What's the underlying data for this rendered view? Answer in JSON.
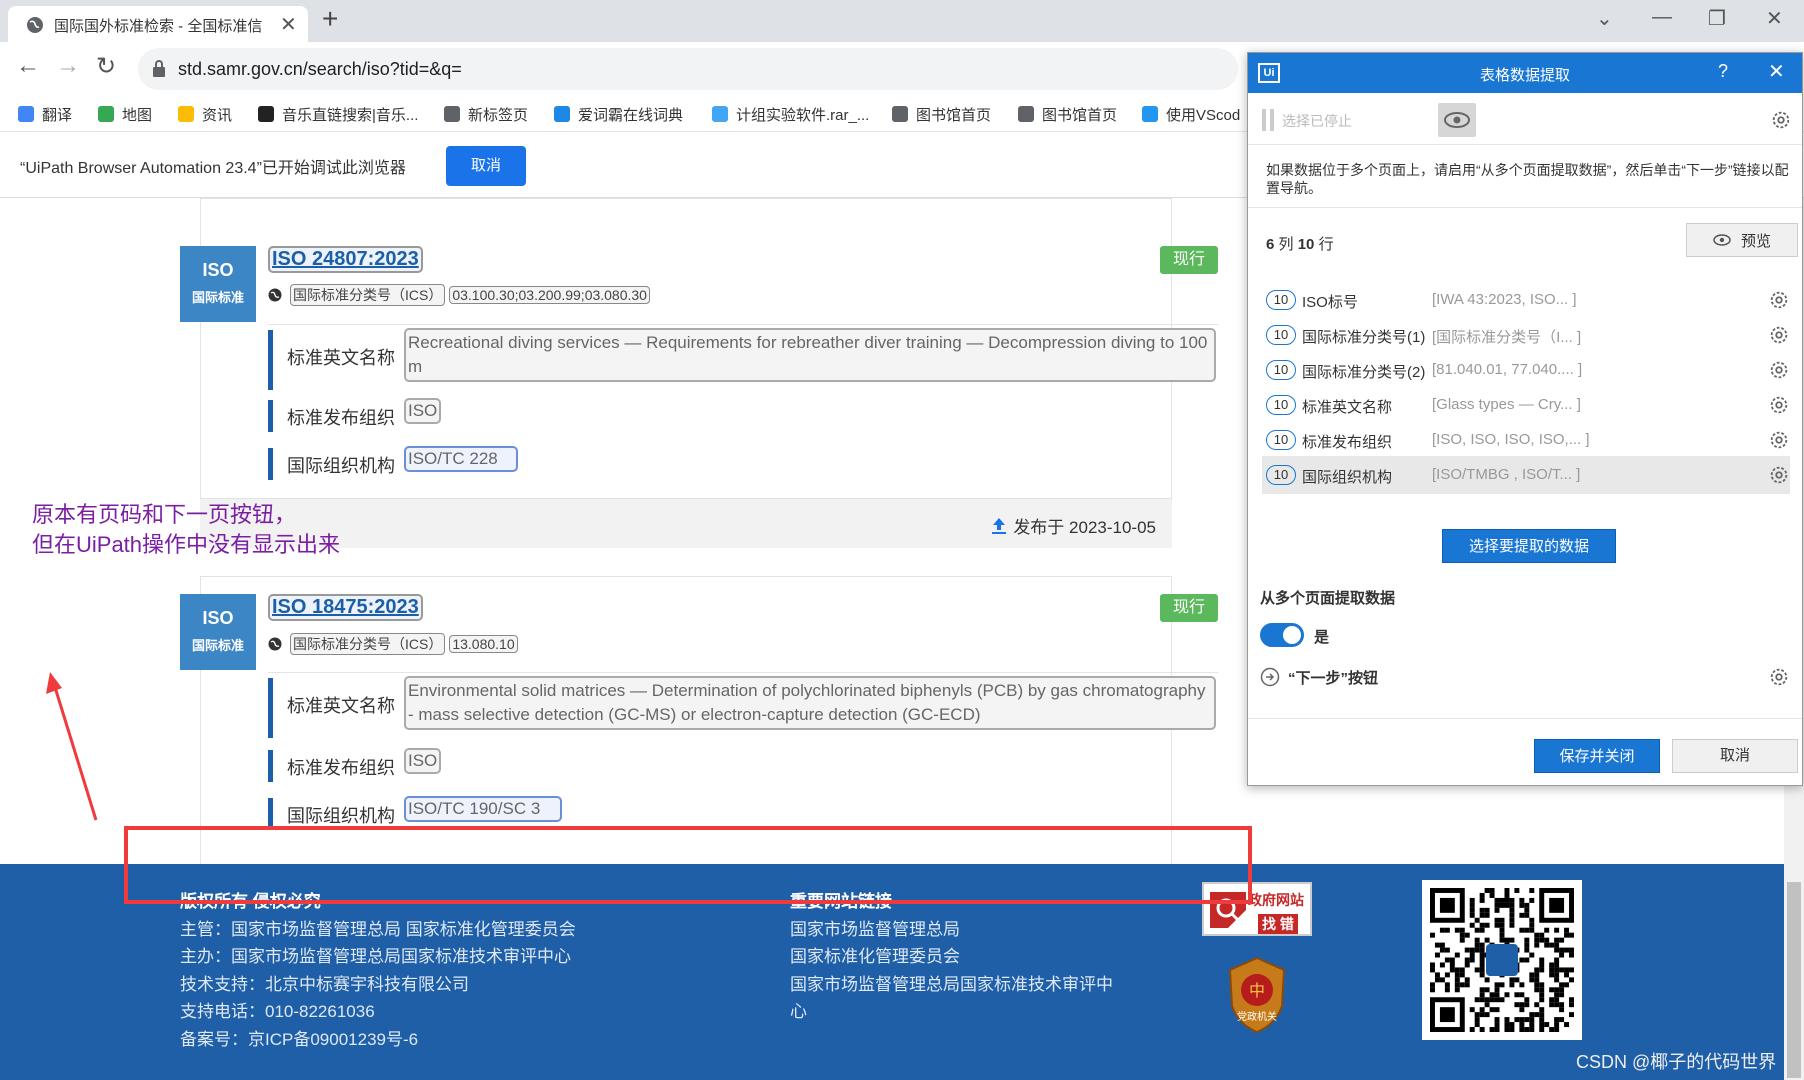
{
  "browser": {
    "tab_title": "国际国外标准检索 - 全国标准信",
    "tab_close": "✕",
    "new_tab": "+",
    "url": "std.samr.gov.cn/search/iso?tid=&q=",
    "window_controls": {
      "chevron": "⌄",
      "minimize": "—",
      "restore": "❐",
      "close": "✕"
    },
    "nav": {
      "back": "←",
      "forward": "→",
      "reload": "↻"
    },
    "bookmarks": [
      {
        "label": "翻译",
        "color": "#4285f4"
      },
      {
        "label": "地图",
        "color": "#34a853"
      },
      {
        "label": "资讯",
        "color": "#fbbc05"
      },
      {
        "label": "音乐直链搜索|音乐...",
        "color": "#222222"
      },
      {
        "label": "新标签页",
        "color": "#5f6368"
      },
      {
        "label": "爱词霸在线词典",
        "color": "#1e88e5"
      },
      {
        "label": "计组实验软件.rar_...",
        "color": "#42a5f5"
      },
      {
        "label": "图书馆首页",
        "color": "#5f6368"
      },
      {
        "label": "图书馆首页",
        "color": "#5f6368"
      },
      {
        "label": "使用VScod",
        "color": "#2196f3"
      }
    ],
    "infobar": {
      "message": "“UiPath Browser Automation 23.4”已开始调试此浏览器",
      "cancel": "取消"
    }
  },
  "results": [
    {
      "badge_top": "ISO",
      "badge_bottom": "国际标准",
      "number": "ISO 24807:2023",
      "status": "现行",
      "ics_label": "国际标准分类号（ICS）",
      "ics_value": "03.100.30;03.200.99;03.080.30",
      "english_name_label": "标准英文名称",
      "english_name": "Recreational diving services — Requirements for rebreather diver training — Decompression diving to 100 m",
      "publisher_label": "标准发布组织",
      "publisher": "ISO",
      "committee_label": "国际组织机构",
      "committee": "ISO/TC 228",
      "published": "发布于 2023-10-05"
    },
    {
      "badge_top": "ISO",
      "badge_bottom": "国际标准",
      "number": "ISO 18475:2023",
      "status": "现行",
      "ics_label": "国际标准分类号（ICS）",
      "ics_value": "13.080.10",
      "english_name_label": "标准英文名称",
      "english_name": "Environmental solid matrices — Determination of polychlorinated biphenyls (PCB) by gas chromatography - mass selective detection (GC-MS) or electron-capture detection (GC-ECD)",
      "publisher_label": "标准发布组织",
      "publisher": "ISO",
      "committee_label": "国际组织机构",
      "committee": "ISO/TC 190/SC 3"
    }
  ],
  "annotation": {
    "line1": "原本有页码和下一页按钮，",
    "line2": "但在UiPath操作中没有显示出来"
  },
  "footer": {
    "col1_heading": "版权所有 侵权必究",
    "col1_lines": [
      "主管：国家市场监督管理总局 国家标准化管理委员会",
      "主办：国家市场监督管理总局国家标准技术审评中心",
      "技术支持：北京中标赛宇科技有限公司",
      "支持电话：010-82261036",
      "备案号：京ICP备09001239号-6"
    ],
    "col2_heading": "重要网站链接",
    "col2_lines": [
      "国家市场监督管理总局",
      "国家标准化管理委员会",
      "国家市场监督管理总局国家标准技术审评中心"
    ],
    "gov_box_line1": "政府网站",
    "gov_box_line2": "找 错",
    "emblem_text": "党政机关",
    "watermark": "CSDN @椰子的代码世界"
  },
  "dialog": {
    "logo": "Ui",
    "title": "表格数据提取",
    "help": "?",
    "close": "✕",
    "paused_label": "选择已停止",
    "note": "如果数据位于多个页面上，请启用“从多个页面提取数据”，然后单击“下一步”链接以配置导航。",
    "count_cols": "6",
    "count_cols_unit": "列",
    "count_rows": "10",
    "count_rows_unit": "行",
    "preview": "预览",
    "columns": [
      {
        "count": "10",
        "name": "ISO标号",
        "preview": "[IWA 43:2023, ISO... ]"
      },
      {
        "count": "10",
        "name": "国际标准分类号(1)",
        "preview": "[国际标准分类号（I... ]"
      },
      {
        "count": "10",
        "name": "国际标准分类号(2)",
        "preview": "[81.040.01, 77.040.... ]"
      },
      {
        "count": "10",
        "name": "标准英文名称",
        "preview": "[Glass types — Cry... ]"
      },
      {
        "count": "10",
        "name": "标准发布组织",
        "preview": "[ISO, ISO, ISO, ISO,... ]"
      },
      {
        "count": "10",
        "name": "国际组织机构",
        "preview": "[ISO/TMBG , ISO/T... ]"
      }
    ],
    "select_data_button": "选择要提取的数据",
    "multi_page_label": "从多个页面提取数据",
    "toggle_label": "是",
    "next_button_label": "“下一步”按钮",
    "save_button": "保存并关闭",
    "cancel_button": "取消"
  }
}
